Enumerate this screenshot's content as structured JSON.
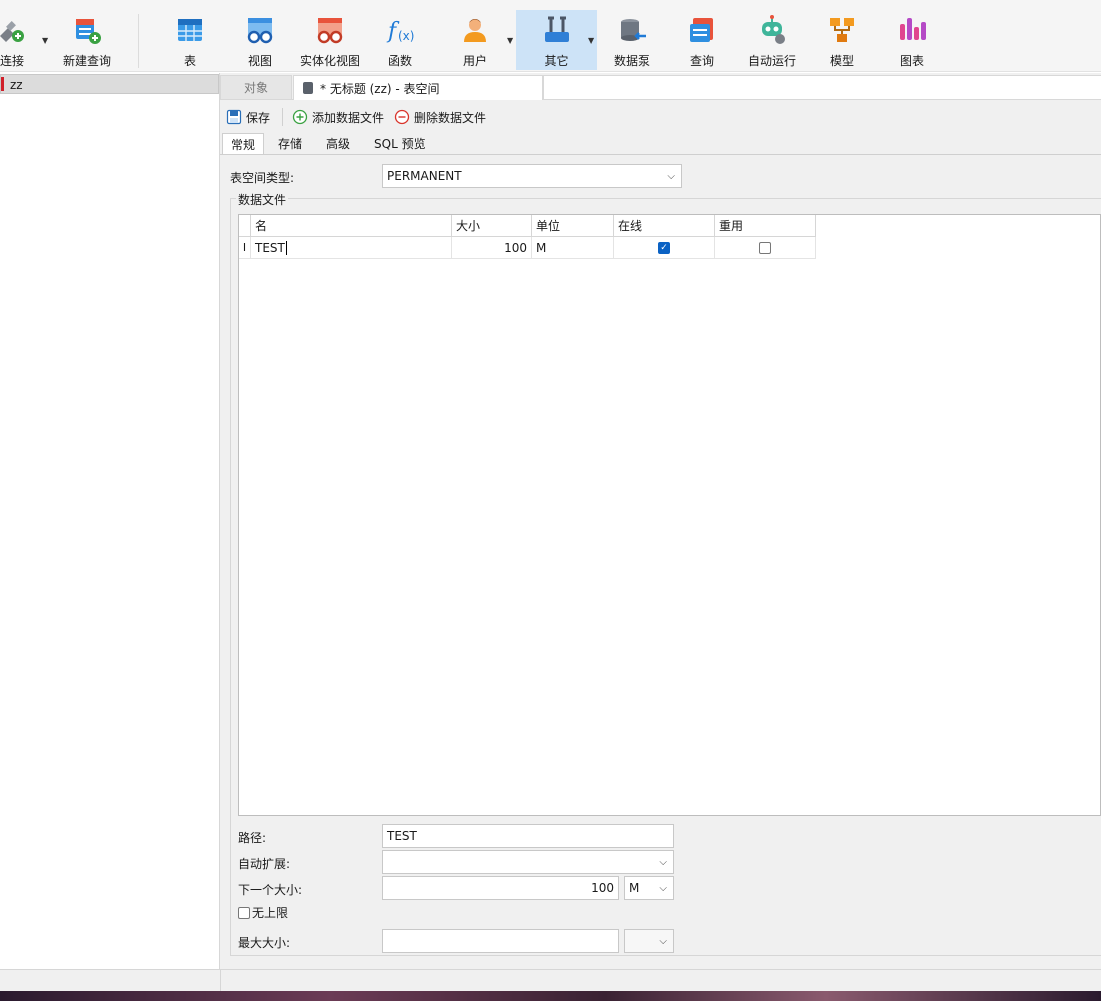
{
  "toolbar": {
    "items": [
      {
        "label": "连接",
        "icon": "connection-plug-icon"
      },
      {
        "label": "新建查询",
        "icon": "new-query-icon"
      },
      {
        "label": "表",
        "icon": "table-icon"
      },
      {
        "label": "视图",
        "icon": "view-icon"
      },
      {
        "label": "实体化视图",
        "icon": "materialized-view-icon"
      },
      {
        "label": "函数",
        "icon": "function-icon"
      },
      {
        "label": "用户",
        "icon": "user-icon"
      },
      {
        "label": "其它",
        "icon": "tools-icon"
      },
      {
        "label": "数据泵",
        "icon": "data-pump-icon"
      },
      {
        "label": "查询",
        "icon": "query-icon"
      },
      {
        "label": "自动运行",
        "icon": "robot-icon"
      },
      {
        "label": "模型",
        "icon": "model-icon"
      },
      {
        "label": "图表",
        "icon": "chart-icon"
      }
    ]
  },
  "tree": {
    "selected": "zz"
  },
  "tabs": {
    "objects": "对象",
    "document": "* 无标题 (zz) - 表空间"
  },
  "actions": {
    "save": "保存",
    "add_datafile": "添加数据文件",
    "delete_datafile": "删除数据文件"
  },
  "subtabs": [
    "常规",
    "存储",
    "高级",
    "SQL 预览"
  ],
  "form": {
    "tablespace_type_label": "表空间类型:",
    "tablespace_type_value": "PERMANENT",
    "datafiles_label": "数据文件",
    "path_label": "路径:",
    "path_value": "TEST",
    "autoextend_label": "自动扩展:",
    "autoextend_value": "",
    "next_size_label": "下一个大小:",
    "next_size_value": "100",
    "next_size_unit": "M",
    "unlimited_label": "无上限",
    "max_size_label": "最大大小:",
    "max_size_value": "",
    "max_size_unit": ""
  },
  "grid": {
    "columns": [
      "名",
      "大小",
      "单位",
      "在线",
      "重用"
    ],
    "rows": [
      {
        "name": "TEST",
        "size": "100",
        "unit": "M",
        "online": true,
        "reuse": false
      }
    ]
  },
  "colors": {
    "accent": "#0b62c4",
    "selected_tool": "#cde3f7"
  }
}
